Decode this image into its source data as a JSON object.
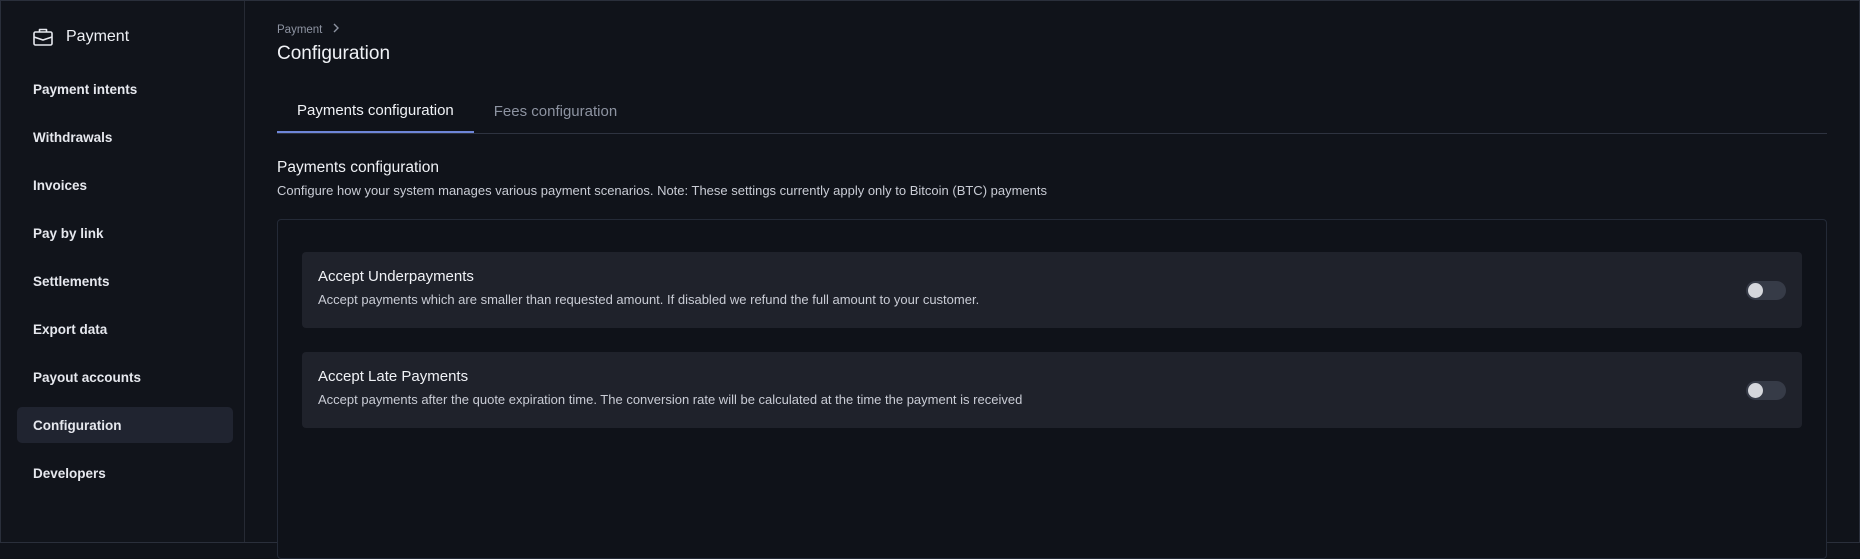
{
  "sidebar": {
    "brand": {
      "label": "Payment",
      "icon": "briefcase-icon"
    },
    "items": [
      {
        "label": "Payment intents",
        "active": false
      },
      {
        "label": "Withdrawals",
        "active": false
      },
      {
        "label": "Invoices",
        "active": false
      },
      {
        "label": "Pay by link",
        "active": false
      },
      {
        "label": "Settlements",
        "active": false
      },
      {
        "label": "Export data",
        "active": false
      },
      {
        "label": "Payout accounts",
        "active": false
      },
      {
        "label": "Configuration",
        "active": true
      },
      {
        "label": "Developers",
        "active": false
      }
    ]
  },
  "header": {
    "breadcrumb": "Payment",
    "breadcrumb_separator_icon": "chevron-right-icon",
    "title": "Configuration"
  },
  "tabs": [
    {
      "label": "Payments configuration",
      "active": true
    },
    {
      "label": "Fees configuration",
      "active": false
    }
  ],
  "section": {
    "title": "Payments configuration",
    "description": "Configure how your system manages various payment scenarios. Note: These settings currently apply only to Bitcoin (BTC) payments"
  },
  "settings": [
    {
      "title": "Accept Underpayments",
      "description": "Accept payments which are smaller than requested amount. If disabled we refund the full amount to your customer.",
      "enabled": false
    },
    {
      "title": "Accept Late Payments",
      "description": "Accept payments after the quote expiration time. The conversion rate will be calculated at the time the payment is received",
      "enabled": false
    }
  ],
  "colors": {
    "background": "#10131a",
    "active_nav": "#202430",
    "tab_underline": "#6e86d8",
    "card": "#1f222b"
  }
}
